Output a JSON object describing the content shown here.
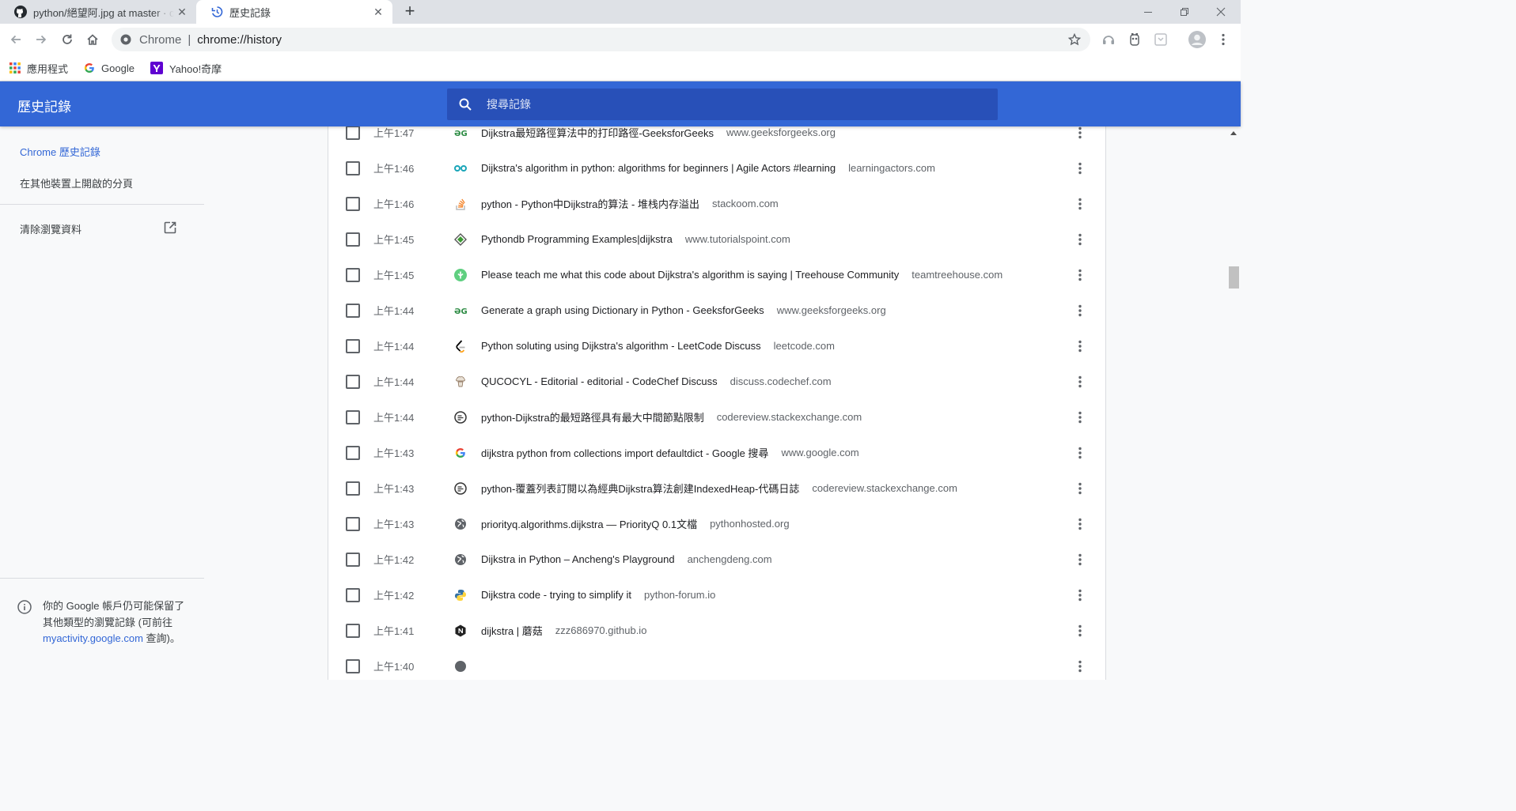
{
  "tabs": [
    {
      "title": "python/絕望阿.jpg at master · c",
      "icon": "github-icon"
    },
    {
      "title": "歷史記錄",
      "icon": "history-icon"
    }
  ],
  "toolbar": {
    "site_name": "Chrome",
    "separator": "|",
    "url": "chrome://history"
  },
  "bookmarks": [
    {
      "label": "應用程式",
      "icon": "apps-grid-icon"
    },
    {
      "label": "Google",
      "icon": "google-icon"
    },
    {
      "label": "Yahoo!奇摩",
      "icon": "yahoo-icon"
    }
  ],
  "header": {
    "title": "歷史記錄",
    "search_placeholder": "搜尋記錄"
  },
  "sidebar": {
    "items": [
      {
        "label": "Chrome 歷史記錄",
        "selected": true
      },
      {
        "label": "在其他裝置上開啟的分頁",
        "selected": false
      },
      {
        "label": "清除瀏覽資料",
        "selected": false
      }
    ],
    "note": {
      "text_before": "你的 Google 帳戶仍可能保留了其他類型的瀏覽記錄 (可前往",
      "link": "myactivity.google.com",
      "text_after": "查詢)。"
    }
  },
  "history": [
    {
      "time": "上午1:47",
      "title": "Dijkstra最短路徑算法中的打印路徑-GeeksforGeeks",
      "domain": "www.geeksforgeeks.org",
      "icon": "geeksforgeeks-icon"
    },
    {
      "time": "上午1:46",
      "title": "Dijkstra's algorithm in python: algorithms for beginners | Agile Actors #learning",
      "domain": "learningactors.com",
      "icon": "learningactors-icon"
    },
    {
      "time": "上午1:46",
      "title": "python - Python中Dijkstra的算法 - 堆栈内存溢出",
      "domain": "stackoom.com",
      "icon": "stackoom-icon"
    },
    {
      "time": "上午1:45",
      "title": "Pythondb Programming Examples|dijkstra",
      "domain": "www.tutorialspoint.com",
      "icon": "tutorialspoint-icon"
    },
    {
      "time": "上午1:45",
      "title": "Please teach me what this code about Dijkstra's algorithm is saying | Treehouse Community",
      "domain": "teamtreehouse.com",
      "icon": "treehouse-icon"
    },
    {
      "time": "上午1:44",
      "title": "Generate a graph using Dictionary in Python - GeeksforGeeks",
      "domain": "www.geeksforgeeks.org",
      "icon": "geeksforgeeks-icon"
    },
    {
      "time": "上午1:44",
      "title": "Python soluting using Dijkstra's algorithm - LeetCode Discuss",
      "domain": "leetcode.com",
      "icon": "leetcode-icon"
    },
    {
      "time": "上午1:44",
      "title": "QUCOCYL - Editorial - editorial - CodeChef Discuss",
      "domain": "discuss.codechef.com",
      "icon": "codechef-icon"
    },
    {
      "time": "上午1:44",
      "title": "python-Dijkstra的最短路徑具有最大中間節點限制",
      "domain": "codereview.stackexchange.com",
      "icon": "codereview-icon"
    },
    {
      "time": "上午1:43",
      "title": "dijkstra python from collections import defaultdict - Google 搜尋",
      "domain": "www.google.com",
      "icon": "google-icon"
    },
    {
      "time": "上午1:43",
      "title": "python-覆蓋列表訂閱以為經典Dijkstra算法創建IndexedHeap-代碼日誌",
      "domain": "codereview.stackexchange.com",
      "icon": "codereview-icon"
    },
    {
      "time": "上午1:43",
      "title": "priorityq.algorithms.dijkstra — PriorityQ 0.1文檔",
      "domain": "pythonhosted.org",
      "icon": "globe-icon"
    },
    {
      "time": "上午1:42",
      "title": "Dijkstra in Python – Ancheng's Playground",
      "domain": "anchengdeng.com",
      "icon": "globe-icon"
    },
    {
      "time": "上午1:42",
      "title": "Dijkstra code - trying to simplify it",
      "domain": "python-forum.io",
      "icon": "python-icon"
    },
    {
      "time": "上午1:41",
      "title": "dijkstra | 蘑菇",
      "domain": "zzz686970.github.io",
      "icon": "n-logo-icon"
    },
    {
      "time": "上午1:40",
      "title": "",
      "domain": "",
      "icon": "globe-icon"
    }
  ]
}
